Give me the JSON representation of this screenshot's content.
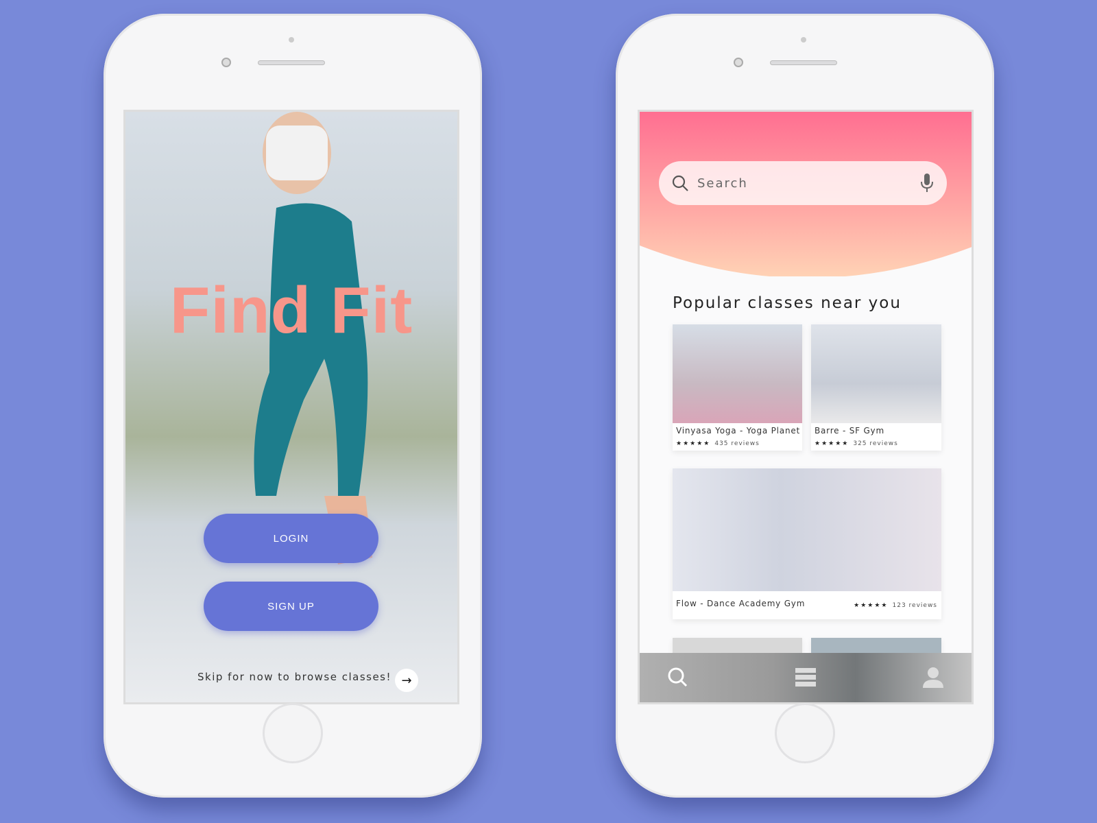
{
  "welcome": {
    "title": "Find Fit",
    "login_label": "LOGIN",
    "signup_label": "SIGN UP",
    "skip_text": "Skip for now to browse classes!",
    "skip_icon": "arrow-right-icon"
  },
  "browse": {
    "search": {
      "placeholder": "Search",
      "icon": "search-icon",
      "mic_icon": "microphone-icon"
    },
    "heading": "Popular classes near you",
    "classes": [
      {
        "name": "Vinyasa Yoga - Yoga Planet",
        "stars": "★★★★★",
        "reviews": "435 reviews"
      },
      {
        "name": "Barre - SF Gym",
        "stars": "★★★★★",
        "reviews": "325 reviews"
      },
      {
        "name": "Flow - Dance Academy Gym",
        "stars": "★★★★★",
        "reviews": "123 reviews"
      }
    ],
    "nav": [
      "search-icon",
      "list-icon",
      "profile-icon"
    ]
  },
  "colors": {
    "background": "#7889d9",
    "button": "#6674d6",
    "title": "#f7968a",
    "header_top": "#ff6f91",
    "header_bottom": "#ffd2b5"
  }
}
